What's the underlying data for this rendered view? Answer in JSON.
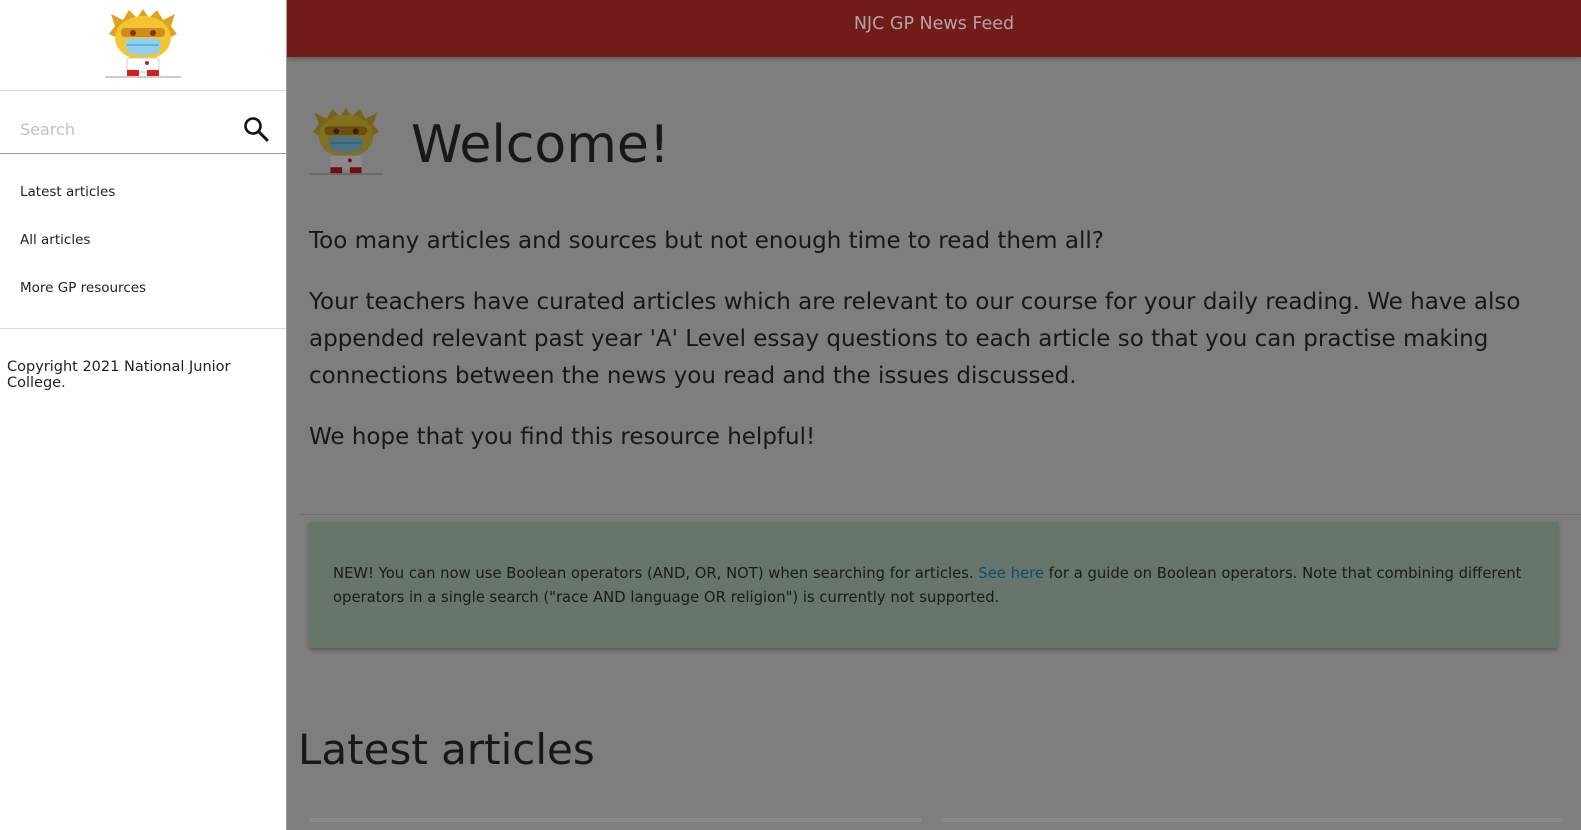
{
  "sidebar": {
    "logo_alt": "NJC mascot logo",
    "search": {
      "placeholder": "Search",
      "value": ""
    },
    "nav_items": [
      {
        "label": "Latest articles"
      },
      {
        "label": "All articles"
      },
      {
        "label": "More GP resources"
      }
    ],
    "copyright": "Copyright 2021 National Junior College."
  },
  "header": {
    "title": "NJC GP News Feed",
    "background_color": "#711c1b"
  },
  "main": {
    "welcome_title": "Welcome!",
    "paragraphs": [
      "Too many articles and sources but not enough time to read them all?",
      "Your teachers have curated articles which are relevant to our course for your daily reading. We have also appended relevant past year 'A' Level essay questions to each article so that you can practise making connections between the news you read and the issues discussed.",
      "We hope that you find this resource helpful!"
    ],
    "notice": {
      "before_link": "NEW! You can now use Boolean operators (AND, OR, NOT) when searching for articles. ",
      "link_text": "See here",
      "after_link": " for a guide on Boolean operators. Note that combining different operators in a single search (\"race AND language OR religion\") is currently not supported.",
      "background_color": "#67756a"
    },
    "latest_heading": "Latest articles"
  },
  "icons": {
    "search": "search-icon",
    "mascot": "mascot-logo"
  }
}
